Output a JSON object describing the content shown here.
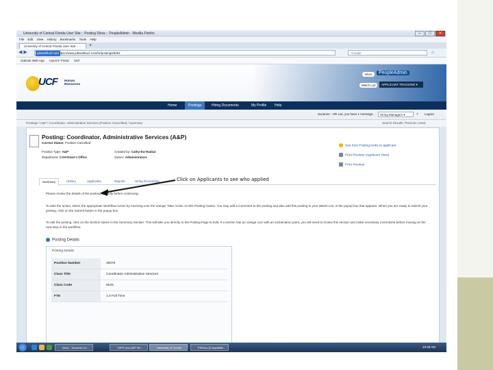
{
  "browser": {
    "window_title": "University of Central Florida User Site :: Posting Show :: PeopleAdmin - Mozilla Firefox",
    "menu": [
      "File",
      "Edit",
      "View",
      "History",
      "Bookmarks",
      "Tools",
      "Help"
    ],
    "tab_label": "University of Central Florida User Site :: ...",
    "url_host": "jobswithucf.com",
    "url": "https://www.jobswithucf.com/hr/postings/8291",
    "search_placeholder": "Google",
    "bookmarks": [
      "Outlook Web App",
      "myUCF Portal",
      "UCF"
    ]
  },
  "site": {
    "logo_text": "UCF",
    "logo_subtitle": "Human Resources",
    "inbox": "Inbox",
    "brand": "PeopleAdmin",
    "watch_list": "Watch List",
    "app_selector": "APPLICANT TRACKING",
    "nav": [
      "Home",
      "Postings",
      "Hiring Documents",
      "My Profile",
      "Help"
    ],
    "active_nav": "Postings",
    "user_line": "Suzanne - HR Liai, you have 1 message.",
    "role_select": "Hiring Managers",
    "help": "?",
    "logout": "Logout",
    "breadcrumb": "Postings / A&P / Coordinator, Administrative Services (Position Cancelled) / Summary",
    "search_results": "Search Results: Previous | Next"
  },
  "posting": {
    "title": "Posting: Coordinator, Administrative Services (A&P)",
    "status_label": "Current Status:",
    "status_value": "Position Cancelled",
    "position_type_label": "Position Type:",
    "position_type": "A&P",
    "department_label": "Department:",
    "department": "CAH-Dean's Office",
    "created_by_label": "Created by:",
    "created_by": "Cathy-EU Radzai",
    "owner_label": "Owner:",
    "owner": "Administrators",
    "side_links": [
      "See how Posting looks to applicant",
      "Print Preview (Applicant View)",
      "Print Preview"
    ],
    "tabs": [
      "Summary",
      "History",
      "Applicants",
      "Reports",
      "Hiring Documents"
    ],
    "active_tab": "Summary",
    "intro": "Please review the details of the posting carefully before continuing.",
    "para1": "To take the action, select the appropriate Workflow Action by hovering over the orange 'Take Action on this Posting' button. You may add a Comment to the posting and also add this posting to your Watch List, in the popup box that appears. When you are ready to submit your posting, click on the Submit button in the popup box.",
    "para2": "To edit the posting, click on the Section Name in the Summary Section. This will take you directly to the Posting Page to Edit. If a section has an orange icon with an exclamation point, you will need to review this section and make necessary corrections before moving on the next step in the workflow.",
    "details_heading": "Posting Details",
    "details_caption": "Posting Details",
    "details": [
      {
        "label": "Position Number",
        "value": "30070"
      },
      {
        "label": "Class Title",
        "value": "Coordinator Administrative Services"
      },
      {
        "label": "Class Code",
        "value": "9225"
      },
      {
        "label": "FTE",
        "value": "1.0 Full Time"
      }
    ]
  },
  "annotation": "Click on Applicants to see who applied",
  "taskbar": {
    "tasks": [
      "Inbox - Suzanne.Lin...",
      "USPS and A&P Hiri...",
      "University of Central ...",
      "PSEdoc [Compatibili..."
    ],
    "time": "10:28 AM"
  },
  "colors": {
    "nav_bg": "#0d2f5e",
    "nav_active": "#3f77bd",
    "link": "#2c55a3",
    "slide_rail": "#f4f4ef",
    "slide_block": "#c9c9a3"
  }
}
